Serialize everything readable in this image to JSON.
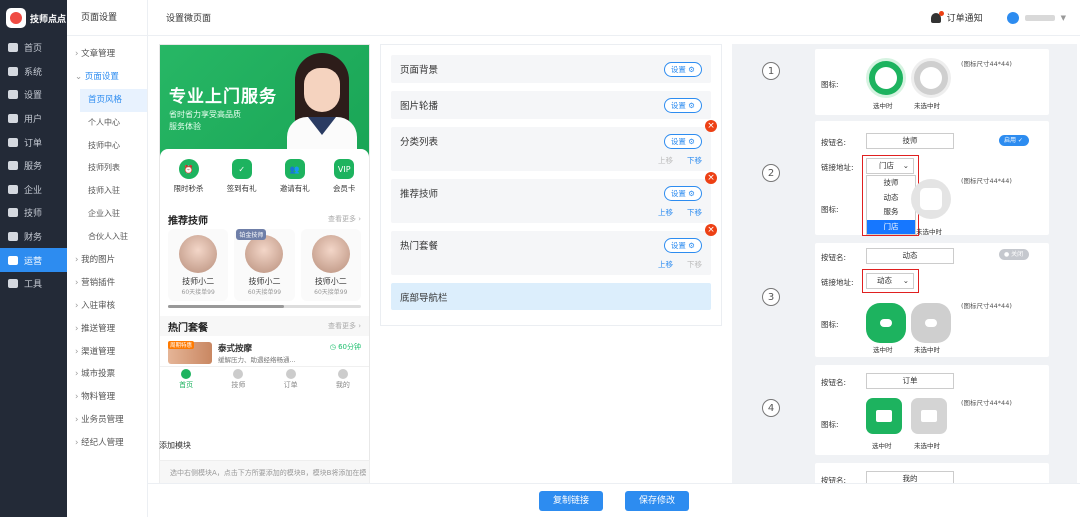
{
  "app": {
    "name": "技师点点",
    "header_title": "页面设置",
    "page_title": "设置微页面",
    "order_notice": "订单通知"
  },
  "sidebar": {
    "items": [
      {
        "label": "首页"
      },
      {
        "label": "系统"
      },
      {
        "label": "设置"
      },
      {
        "label": "用户"
      },
      {
        "label": "订单"
      },
      {
        "label": "服务"
      },
      {
        "label": "企业"
      },
      {
        "label": "技师"
      },
      {
        "label": "财务"
      },
      {
        "label": "运营",
        "active": true
      },
      {
        "label": "工具"
      }
    ]
  },
  "subnav": {
    "items": [
      {
        "label": "文章管理",
        "type": "group"
      },
      {
        "label": "页面设置",
        "type": "group",
        "open": true
      },
      {
        "label": "首页风格",
        "type": "child",
        "selected": true
      },
      {
        "label": "个人中心",
        "type": "child"
      },
      {
        "label": "技师中心",
        "type": "child"
      },
      {
        "label": "技师列表",
        "type": "child"
      },
      {
        "label": "技师入驻",
        "type": "child"
      },
      {
        "label": "企业入驻",
        "type": "child"
      },
      {
        "label": "合伙人入驻",
        "type": "child"
      },
      {
        "label": "我的图片",
        "type": "group"
      },
      {
        "label": "营销插件",
        "type": "group"
      },
      {
        "label": "入驻审核",
        "type": "group"
      },
      {
        "label": "推送管理",
        "type": "group"
      },
      {
        "label": "渠道管理",
        "type": "group"
      },
      {
        "label": "城市投票",
        "type": "group"
      },
      {
        "label": "物料管理",
        "type": "group"
      },
      {
        "label": "业务员管理",
        "type": "group"
      },
      {
        "label": "经纪人管理",
        "type": "group"
      }
    ]
  },
  "preview": {
    "banner_title": "专业上门服务",
    "banner_line1": "省时省力享受高品质",
    "banner_line2": "服务体验",
    "quick_icons": [
      {
        "label": "限时秒杀"
      },
      {
        "label": "签到有礼"
      },
      {
        "label": "邀请有礼"
      },
      {
        "label": "会员卡"
      }
    ],
    "tech_section": {
      "title": "推荐技师",
      "more": "查看更多 ›"
    },
    "techs": [
      {
        "name": "技师小二",
        "sub": "60天接单99"
      },
      {
        "name": "技师小二",
        "sub": "60天接单99",
        "badge": "铂金技师"
      },
      {
        "name": "技师小二",
        "sub": "60天接单99"
      }
    ],
    "hot_section": {
      "title": "热门套餐",
      "more": "查看更多 ›"
    },
    "hot_item": {
      "name": "泰式按摩",
      "desc": "缓解压力、助遇经络畅通...",
      "time": "60分钟",
      "tag": "周期特惠"
    },
    "tabbar": [
      {
        "label": "首页",
        "on": true
      },
      {
        "label": "技师"
      },
      {
        "label": "订单"
      },
      {
        "label": "我的"
      }
    ],
    "add_module_label": "添加模块",
    "add_hint": "选中右侧模块A，点击下方所要添加的模块B，模块B将添加在模"
  },
  "modules": [
    {
      "title": "页面背景",
      "btn": "设置 ⚙"
    },
    {
      "title": "图片轮播",
      "btn": "设置 ⚙"
    },
    {
      "title": "分类列表",
      "btn": "设置 ⚙",
      "deletable": true,
      "move": [
        "上移",
        "下移"
      ]
    },
    {
      "title": "推荐技师",
      "btn": "设置 ⚙",
      "deletable": true,
      "move": [
        "上移",
        "下移"
      ]
    },
    {
      "title": "热门套餐",
      "btn": "设置 ⚙",
      "deletable": true,
      "move": [
        "上移",
        "下移"
      ]
    },
    {
      "title": "底部导航栏",
      "highlight": true
    }
  ],
  "navcfg": {
    "btn_name_label": "按钮名:",
    "link_label": "链接地址:",
    "icon_label": "图标:",
    "selected_label": "选中时",
    "unselected_label": "未选中时",
    "size_hint": "(图标尺寸44*44)",
    "items": [
      {
        "num": "1"
      },
      {
        "num": "2",
        "name": "技师",
        "link": "门店",
        "toggle": "启用",
        "dropdown": [
          "技师",
          "动态",
          "服务",
          "门店"
        ],
        "dropdown_selected": "门店"
      },
      {
        "num": "3",
        "name": "动态",
        "link": "动态",
        "toggle": "关闭"
      },
      {
        "num": "4",
        "name": "订单"
      },
      {
        "name": "我的"
      }
    ]
  },
  "footer": {
    "copy_link": "复制链接",
    "save": "保存修改"
  },
  "colors": {
    "primary": "#2d8cf0",
    "green": "#1db35f",
    "sidebar": "#232a37",
    "danger": "#ed4014"
  }
}
